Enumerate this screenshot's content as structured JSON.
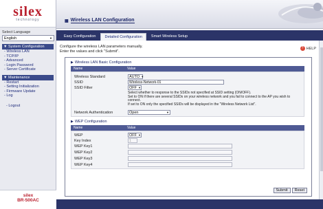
{
  "sidebar": {
    "logo_main": "silex",
    "logo_sub": "technology",
    "language_label": "Select Language",
    "language_value": "English",
    "groups": [
      {
        "title": "System Configuration",
        "items": [
          "Wireless LAN",
          "TCP/IP",
          "Advanced",
          "Login Password",
          "Server Certificate"
        ]
      },
      {
        "title": "Maintenance",
        "items": [
          "Restart",
          "Setting Initialization",
          "Firmware Update",
          "Log"
        ]
      }
    ],
    "logout": "Logout",
    "product_brand": "silex",
    "product_model": "BR-500AC"
  },
  "header": {
    "title": "Wireless LAN Configuration"
  },
  "tabs": [
    {
      "label": "Easy Configuration",
      "active": false
    },
    {
      "label": "Detailed Configuration",
      "active": true
    },
    {
      "label": "Smart Wireless Setup",
      "active": false
    }
  ],
  "content": {
    "intro_line1": "Configure the wireless LAN parameters manually.",
    "intro_line2": "Enter the values and click \"Submit\".",
    "help_label": "HELP",
    "basic": {
      "title": "Wireless LAN Basic Configuration",
      "col_name": "Name",
      "col_value": "Value",
      "standard_label": "Wireless Standard",
      "standard_value": "AUTO",
      "ssid_label": "SSID",
      "ssid_value": "Wireless-Network-01",
      "ssid_filter_label": "SSID Filter",
      "ssid_filter_value": "OFF",
      "desc_line1": "Select whether to response to the SSIDs not specified at SSID setting (ON/OFF).",
      "desc_line2": "Set to ON if there are several SSIDs on your wireless network and you fail to connect to the AP you wish to connect.",
      "desc_line3": "If set to ON only the specified SSIDs will be displayed in the \"Wireless Network List\".",
      "auth_label": "Network Authentication",
      "auth_value": "Open"
    },
    "wep": {
      "title": "WEP Configuration",
      "col_name": "Name",
      "col_value": "Value",
      "wep_label": "WEP",
      "wep_value": "OFF",
      "key_index_label": "Key Index",
      "key_index_value": "1",
      "key1_label": "WEP Key1",
      "key2_label": "WEP Key2",
      "key3_label": "WEP Key3",
      "key4_label": "WEP Key4"
    },
    "submit_label": "Submit",
    "reset_label": "Reset"
  }
}
